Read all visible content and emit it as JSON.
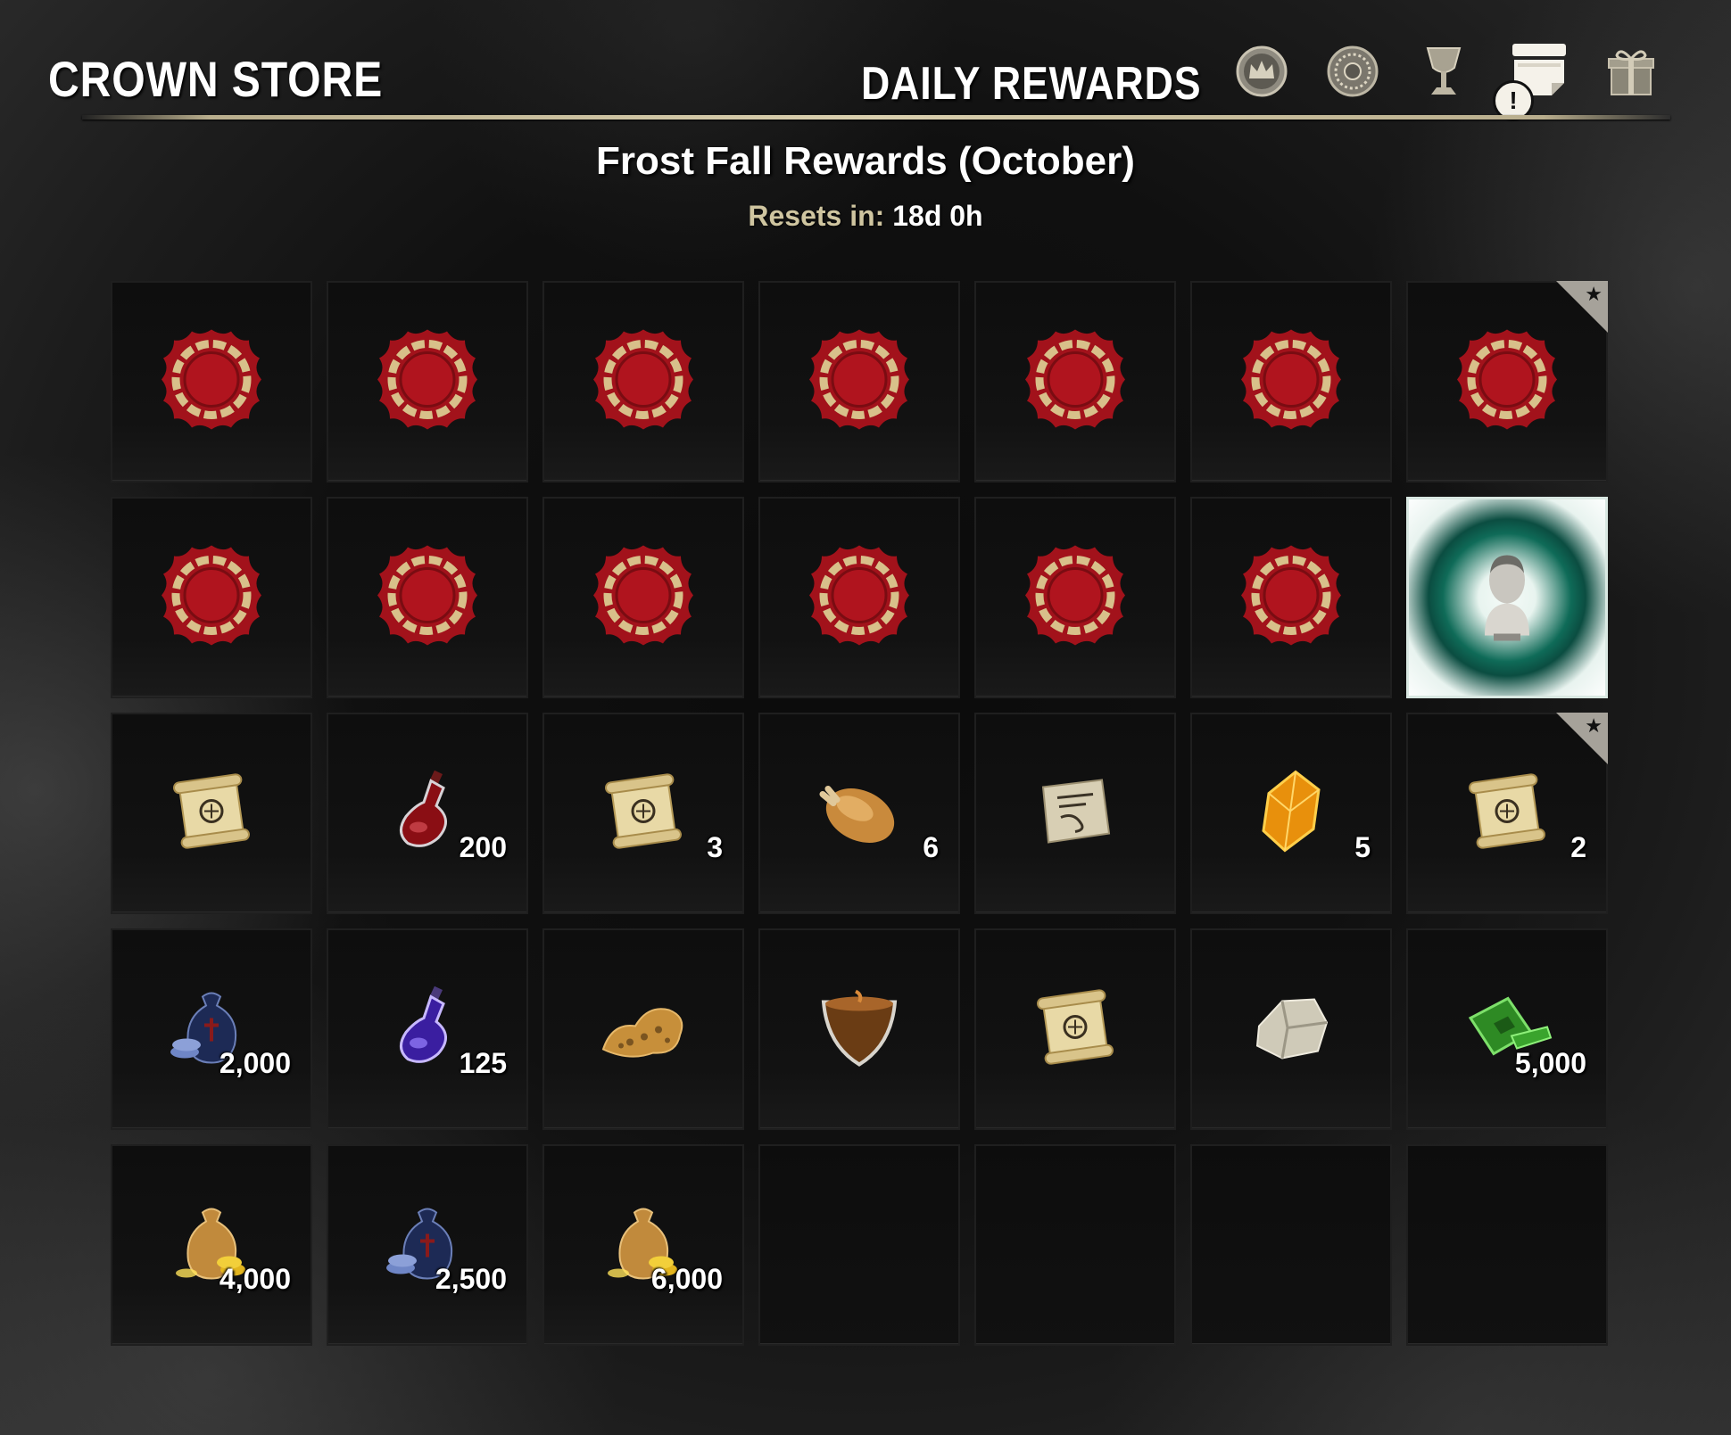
{
  "header": {
    "store_title": "CROWN STORE",
    "section_title": "DAILY REWARDS",
    "tabs": [
      {
        "name": "crown-icon"
      },
      {
        "name": "seal-icon"
      },
      {
        "name": "chalice-icon"
      },
      {
        "name": "daily-rewards-icon",
        "badge": "!"
      },
      {
        "name": "gift-icon"
      }
    ]
  },
  "period": {
    "title": "Frost Fall Rewards (October)",
    "reset_label": "Resets in:",
    "reset_value": "18d 0h"
  },
  "rewards": [
    [
      {
        "icon": "wax-seal-icon",
        "qty": ""
      },
      {
        "icon": "wax-seal-icon",
        "qty": ""
      },
      {
        "icon": "wax-seal-icon",
        "qty": ""
      },
      {
        "icon": "wax-seal-icon",
        "qty": ""
      },
      {
        "icon": "wax-seal-icon",
        "qty": ""
      },
      {
        "icon": "wax-seal-icon",
        "qty": ""
      },
      {
        "icon": "wax-seal-icon",
        "qty": "",
        "starred": true
      }
    ],
    [
      {
        "icon": "wax-seal-icon",
        "qty": ""
      },
      {
        "icon": "wax-seal-icon",
        "qty": ""
      },
      {
        "icon": "wax-seal-icon",
        "qty": ""
      },
      {
        "icon": "wax-seal-icon",
        "qty": ""
      },
      {
        "icon": "wax-seal-icon",
        "qty": ""
      },
      {
        "icon": "wax-seal-icon",
        "qty": ""
      },
      {
        "icon": "bust-icon",
        "qty": "",
        "featured": true
      }
    ],
    [
      {
        "icon": "scroll-icon",
        "qty": ""
      },
      {
        "icon": "red-potion-icon",
        "qty": "200"
      },
      {
        "icon": "scroll-icon",
        "qty": "3"
      },
      {
        "icon": "roast-food-icon",
        "qty": "6"
      },
      {
        "icon": "recipe-paper-icon",
        "qty": ""
      },
      {
        "icon": "amber-crystal-icon",
        "qty": "5"
      },
      {
        "icon": "scroll-icon",
        "qty": "2",
        "starred": true
      }
    ],
    [
      {
        "icon": "blue-coin-bag-icon",
        "qty": "2,000"
      },
      {
        "icon": "purple-potion-icon",
        "qty": "125"
      },
      {
        "icon": "sponge-material-icon",
        "qty": ""
      },
      {
        "icon": "drink-bowl-icon",
        "qty": ""
      },
      {
        "icon": "scroll-icon",
        "qty": ""
      },
      {
        "icon": "stone-material-icon",
        "qty": ""
      },
      {
        "icon": "green-tomes-icon",
        "qty": "5,000"
      }
    ],
    [
      {
        "icon": "gold-coin-bag-icon",
        "qty": "4,000"
      },
      {
        "icon": "blue-coin-bag-icon",
        "qty": "2,500"
      },
      {
        "icon": "gold-coin-bag-icon",
        "qty": "6,000"
      },
      {
        "icon": "empty",
        "qty": ""
      },
      {
        "icon": "empty",
        "qty": ""
      },
      {
        "icon": "empty",
        "qty": ""
      },
      {
        "icon": "empty",
        "qty": ""
      }
    ]
  ],
  "colors": {
    "accent_tan": "#cfc5a0",
    "seal_red": "#a2121b",
    "featured_teal": "#0f6b58"
  }
}
